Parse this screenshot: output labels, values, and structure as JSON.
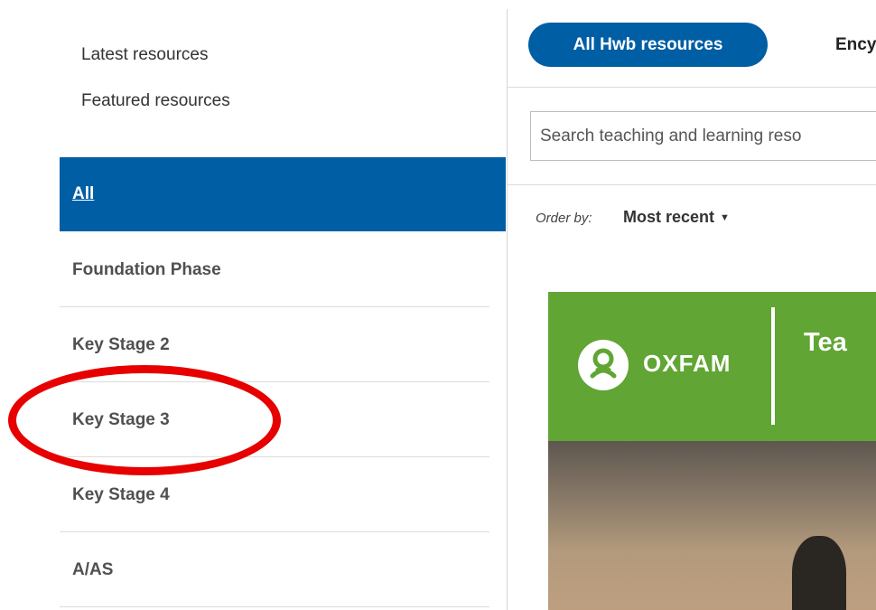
{
  "sidebar": {
    "top_links": [
      "Latest resources",
      "Featured resources"
    ],
    "levels": [
      "All",
      "Foundation Phase",
      "Key Stage 2",
      "Key Stage 3",
      "Key Stage 4",
      "A/AS"
    ]
  },
  "tabs": {
    "active": "All Hwb resources",
    "next": "Ency"
  },
  "search": {
    "placeholder": "Search teaching and learning reso"
  },
  "order": {
    "label": "Order by:",
    "value": "Most recent"
  },
  "card": {
    "brand": "OXFAM",
    "title": "Tea"
  },
  "colors": {
    "brand_blue": "#005ea5",
    "oxfam_green": "#61a534",
    "annotation_red": "#e60000"
  }
}
